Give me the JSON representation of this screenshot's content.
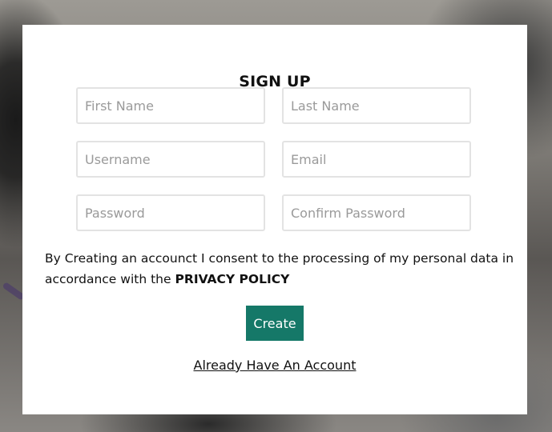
{
  "form": {
    "title": "SIGN UP",
    "fields": {
      "first_name": {
        "placeholder": "First Name",
        "value": ""
      },
      "last_name": {
        "placeholder": "Last Name",
        "value": ""
      },
      "username": {
        "placeholder": "Username",
        "value": ""
      },
      "email": {
        "placeholder": "Email",
        "value": ""
      },
      "password": {
        "placeholder": "Password",
        "value": ""
      },
      "confirm_password": {
        "placeholder": "Confirm Password",
        "value": ""
      }
    },
    "consent_text": "By Creating an accounct I consent to the processing of my personal data in accordance with the",
    "privacy_policy_label": "PRIVACY POLICY",
    "create_label": "Create",
    "already_label": "Already Have An Account"
  },
  "colors": {
    "accent": "#157868",
    "card_background": "#ffffff",
    "field_border": "#e3e3e3"
  }
}
